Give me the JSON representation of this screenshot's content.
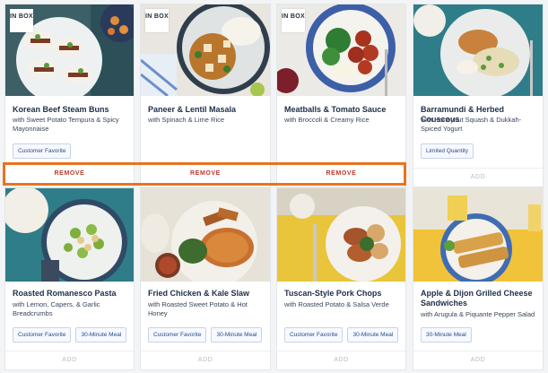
{
  "cards": [
    {
      "title": "Korean Beef Steam Buns",
      "subtitle": "with Sweet Potato Tempura & Spicy Mayonnaise",
      "badge": "IN BOX",
      "tags": [
        "Customer Favorite"
      ],
      "action": "REMOVE"
    },
    {
      "title": "Paneer & Lentil Masala",
      "subtitle": "with Spinach & Lime Rice",
      "badge": "IN BOX",
      "tags": [],
      "action": "REMOVE"
    },
    {
      "title": "Meatballs & Tomato Sauce",
      "subtitle": "with Broccoli & Creamy Rice",
      "badge": "IN BOX",
      "tags": [],
      "action": "REMOVE"
    },
    {
      "title": "Barramundi & Herbed Couscous",
      "subtitle": "with Honeynut Squash & Dukkah-Spiced Yogurt",
      "badge": "",
      "tags": [
        "Limited Quantity"
      ],
      "action": "ADD"
    },
    {
      "title": "Roasted Romanesco Pasta",
      "subtitle": "with Lemon, Capers, & Garlic Breadcrumbs",
      "badge": "",
      "tags": [
        "Customer Favorite",
        "30-Minute Meal"
      ],
      "action": "ADD"
    },
    {
      "title": "Fried Chicken & Kale Slaw",
      "subtitle": "with Roasted Sweet Potato & Hot Honey",
      "badge": "",
      "tags": [
        "Customer Favorite",
        "30-Minute Meal"
      ],
      "action": "ADD"
    },
    {
      "title": "Tuscan-Style Pork Chops",
      "subtitle": "with Roasted Potato & Salsa Verde",
      "badge": "",
      "tags": [
        "Customer Favorite",
        "30-Minute Meal"
      ],
      "action": "ADD"
    },
    {
      "title": "Apple & Dijon Grilled Cheese Sandwiches",
      "subtitle": "with Arugula & Piquante Pepper Salad",
      "badge": "",
      "tags": [
        "30-Minute Meal"
      ],
      "action": "ADD"
    }
  ],
  "colors": {
    "remove": "#c0392b",
    "add": "#b4bcc7",
    "highlight": "#e8731e",
    "title": "#20314a"
  }
}
